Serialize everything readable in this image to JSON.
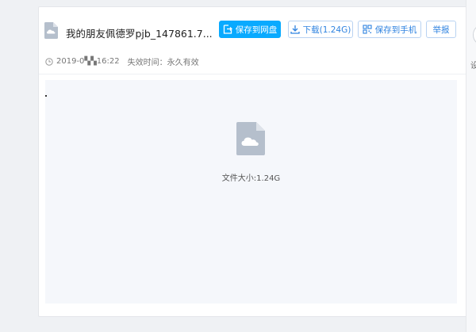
{
  "file": {
    "name": "我的朋友佩德罗pjb_147861.7...",
    "date": "2019-0▚▚16:22",
    "expire": "失效时间：永久有效",
    "size": "文件大小:1.24G"
  },
  "toolbar": {
    "save_label": "保存到网盘",
    "download_label": "下载(1.24G)",
    "phone_label": "保存到手机",
    "report_label": "举报"
  },
  "side_panel": {
    "text": "设"
  },
  "icons": {
    "file": "cloud-file-icon",
    "save": "save-to-cloud-icon",
    "download": "download-icon",
    "phone": "qr-code-icon",
    "clock": "clock-icon"
  },
  "colors": {
    "primary": "#09aaff",
    "link": "#2f83e0",
    "file_icon": "#b5bfcc"
  }
}
